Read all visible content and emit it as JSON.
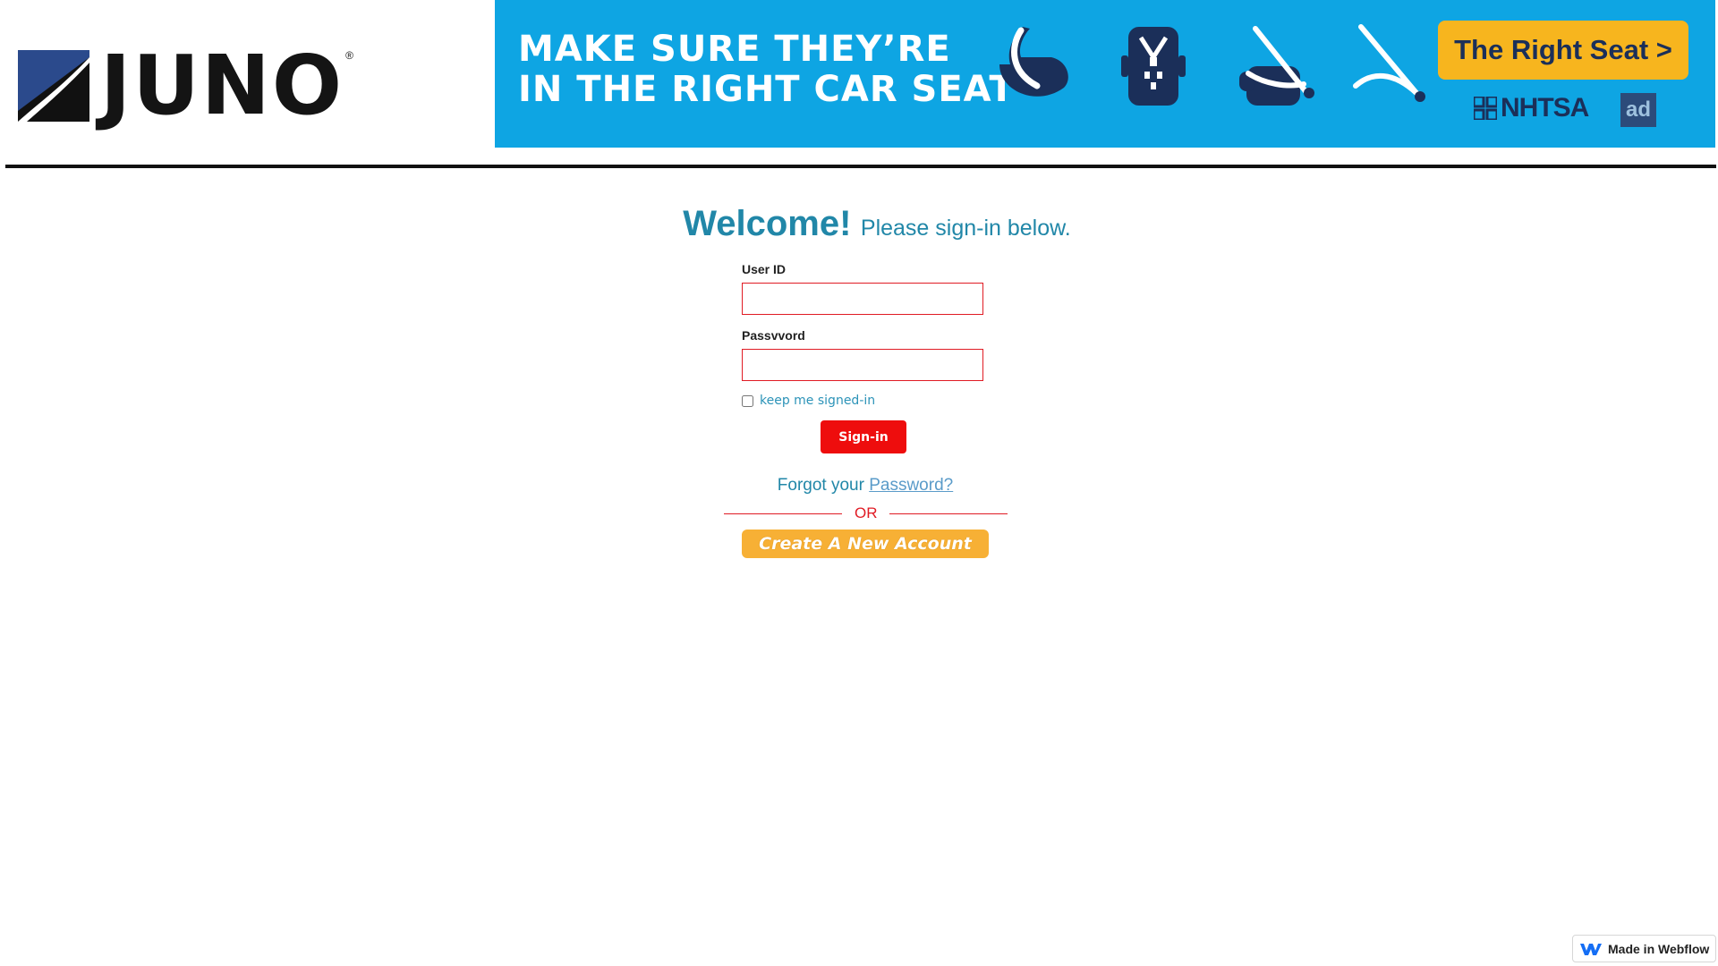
{
  "header": {
    "logo_text": "JUNO",
    "logo_reg": "®"
  },
  "banner": {
    "line1": "MAKE SURE THEY’RE",
    "line2": "IN THE RIGHT CAR SEAT",
    "cta_label": "The Right Seat >",
    "nhtsa_label": "NHTSA",
    "ad_badge": "ad",
    "icons": [
      "infant-seat-icon",
      "convertible-seat-icon",
      "booster-seat-icon",
      "seat-belt-icon"
    ],
    "colors": {
      "background": "#0ea5e3",
      "cta": "#f7b51e",
      "navy": "#1b2f59"
    }
  },
  "login": {
    "welcome": "Welcome!",
    "subtitle": "Please sign-in below.",
    "user_id_label": "User ID",
    "user_id_value": "",
    "password_label": "Passvvord",
    "password_value": "",
    "remember_label": "keep me signed-in",
    "signin_label": "Sign-in",
    "forgot_prefix": "Forgot your",
    "forgot_link": "Password?",
    "or_label": "OR",
    "create_label": "Create A New Account"
  },
  "footer": {
    "webflow_badge": "Made in Webflow"
  },
  "colors": {
    "accent": "#2187a8",
    "danger": "#ee0d0d",
    "create": "#f7b035"
  }
}
